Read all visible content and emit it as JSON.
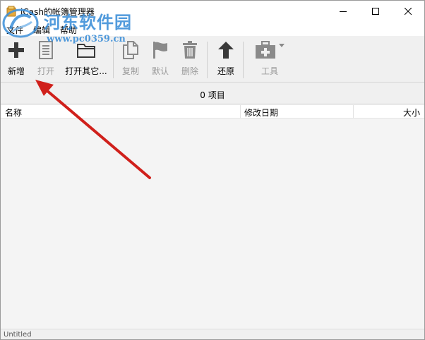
{
  "window": {
    "title": "iCash的帐簿管理器"
  },
  "watermark": {
    "text": "河东软件园",
    "url": "www.pc0359.cn"
  },
  "menu": [
    "文件",
    "编辑",
    "帮助"
  ],
  "toolbar": {
    "buttons": [
      {
        "label": "新增",
        "icon": "plus-icon",
        "enabled": true
      },
      {
        "label": "打开",
        "icon": "document-icon",
        "enabled": false
      },
      {
        "label": "打开其它...",
        "icon": "folder-icon",
        "enabled": true
      },
      {
        "label": "复制",
        "icon": "copy-icon",
        "enabled": false
      },
      {
        "label": "默认",
        "icon": "flag-icon",
        "enabled": false
      },
      {
        "label": "删除",
        "icon": "trash-icon",
        "enabled": false
      },
      {
        "label": "还原",
        "icon": "arrow-up-icon",
        "enabled": true
      },
      {
        "label": "工具",
        "icon": "toolbox-icon",
        "enabled": false
      }
    ]
  },
  "list": {
    "count_text": "0 项目",
    "columns": [
      "名称",
      "修改日期",
      "大小"
    ]
  },
  "status": {
    "text": "Untitled"
  },
  "colors": {
    "enabled_icon": "#3a3a3a",
    "disabled_icon": "#8a8a8a",
    "annotation_arrow": "#d0201b",
    "watermark": "#3b8ed8"
  }
}
